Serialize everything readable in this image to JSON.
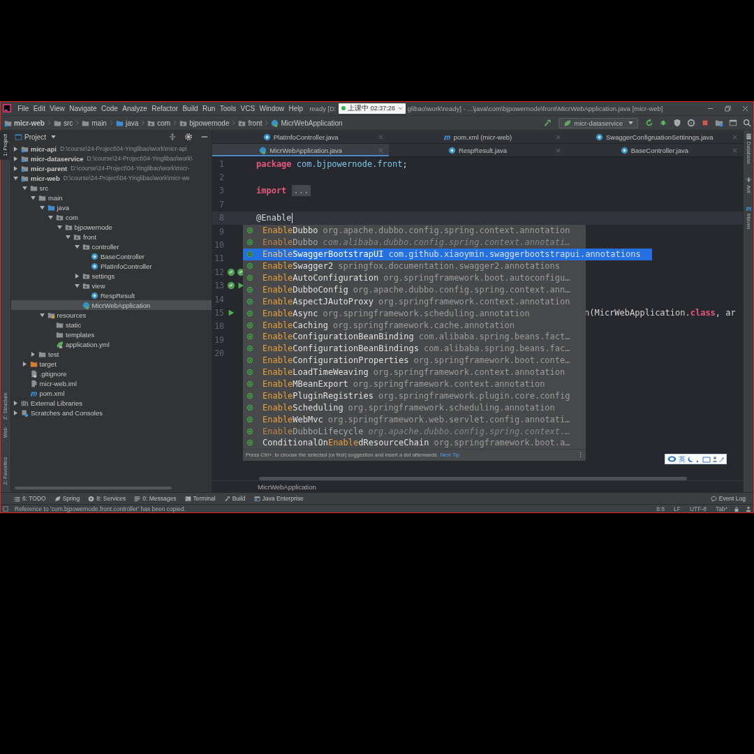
{
  "title_bar": {
    "menus": [
      "File",
      "Edit",
      "View",
      "Navigate",
      "Code",
      "Analyze",
      "Refactor",
      "Build",
      "Run",
      "Tools",
      "VCS",
      "Window",
      "Help"
    ],
    "title_start": "ready [D:",
    "title_end": "glibao\\work\\ready] - ...\\java\\com\\bjpowernode\\front\\MicrWebApplication.java [micr-web]"
  },
  "class_timer": {
    "label": "上课中",
    "time": "02:37:28"
  },
  "nav_bar": {
    "breadcrumbs": [
      {
        "label": "micr-web",
        "kind": "module"
      },
      {
        "label": "src",
        "kind": "folder"
      },
      {
        "label": "main",
        "kind": "folder"
      },
      {
        "label": "java",
        "kind": "source"
      },
      {
        "label": "com",
        "kind": "package"
      },
      {
        "label": "bjpowernode",
        "kind": "package"
      },
      {
        "label": "front",
        "kind": "package"
      },
      {
        "label": "MicrWebApplication",
        "kind": "app-class"
      }
    ],
    "run_config": "micr-dataservice"
  },
  "left_stripe": [
    {
      "label": "1: Project",
      "selected": true
    },
    {
      "label": "Z: Structure",
      "selected": false
    },
    {
      "label": "Web",
      "selected": false
    },
    {
      "label": "2: Favorites",
      "selected": false
    }
  ],
  "project": {
    "title": "Project",
    "tree": [
      {
        "label": "micr-api",
        "path": "D:\\course\\24-Project\\04-Yinglibao\\work\\micr-api",
        "kind": "module",
        "expanded": false,
        "selected": false
      },
      {
        "label": "micr-dataservice",
        "path": "D:\\course\\24-Project\\04-Yinglibao\\work\\",
        "kind": "module",
        "expanded": false,
        "selected": false
      },
      {
        "label": "micr-parent",
        "path": "D:\\course\\24-Project\\04-Yinglibao\\work\\micr-",
        "kind": "module",
        "expanded": false,
        "selected": false
      },
      {
        "label": "micr-web",
        "path": "D:\\course\\24-Project\\04-Yinglibao\\work\\micr-we",
        "kind": "module",
        "expanded": true,
        "selected": false,
        "children": [
          {
            "label": "src",
            "kind": "folder",
            "expanded": true,
            "selected": false,
            "children": [
              {
                "label": "main",
                "kind": "folder",
                "expanded": true,
                "selected": false,
                "children": [
                  {
                    "label": "java",
                    "kind": "source",
                    "expanded": true,
                    "selected": false,
                    "children": [
                      {
                        "label": "com",
                        "kind": "package",
                        "expanded": true,
                        "selected": false,
                        "children": [
                          {
                            "label": "bjpowernode",
                            "kind": "package",
                            "expanded": true,
                            "selected": false,
                            "children": [
                              {
                                "label": "front",
                                "kind": "package",
                                "expanded": true,
                                "selected": false,
                                "children": [
                                  {
                                    "label": "controller",
                                    "kind": "package",
                                    "expanded": true,
                                    "selected": false,
                                    "children": [
                                      {
                                        "label": "BaseController",
                                        "kind": "class",
                                        "selected": false
                                      },
                                      {
                                        "label": "PlatInfoController",
                                        "kind": "class",
                                        "selected": false
                                      }
                                    ]
                                  },
                                  {
                                    "label": "settings",
                                    "kind": "package",
                                    "expanded": false,
                                    "selected": false
                                  },
                                  {
                                    "label": "view",
                                    "kind": "package",
                                    "expanded": true,
                                    "selected": false,
                                    "children": [
                                      {
                                        "label": "RespResult",
                                        "kind": "class",
                                        "selected": false
                                      }
                                    ]
                                  },
                                  {
                                    "label": "MicrWebApplication",
                                    "kind": "app-class",
                                    "selected": true
                                  }
                                ]
                              }
                            ]
                          }
                        ]
                      }
                    ]
                  },
                  {
                    "label": "resources",
                    "kind": "resources",
                    "expanded": true,
                    "selected": false,
                    "children": [
                      {
                        "label": "static",
                        "kind": "folder",
                        "selected": false
                      },
                      {
                        "label": "templates",
                        "kind": "folder",
                        "selected": false
                      },
                      {
                        "label": "application.yml",
                        "kind": "yml",
                        "selected": false
                      }
                    ]
                  }
                ]
              },
              {
                "label": "test",
                "kind": "folder",
                "expanded": false,
                "selected": false
              }
            ]
          },
          {
            "label": "target",
            "kind": "excluded",
            "expanded": false,
            "selected": false
          },
          {
            "label": ".gitignore",
            "kind": "gitignore",
            "selected": false
          },
          {
            "label": "micr-web.iml",
            "kind": "iml",
            "selected": false
          },
          {
            "label": "pom.xml",
            "kind": "maven",
            "selected": false
          }
        ]
      },
      {
        "label": "External Libraries",
        "kind": "libraries",
        "expanded": false,
        "selected": false
      },
      {
        "label": "Scratches and Consoles",
        "kind": "scratches",
        "expanded": false,
        "selected": false
      }
    ]
  },
  "editor": {
    "tab_rows": [
      [
        {
          "label": "PlatInfoController.java",
          "kind": "class",
          "selected": false
        },
        {
          "label": "pom.xml (micr-web)",
          "kind": "maven",
          "selected": false
        },
        {
          "label": "SwaggerConfigruationSettinngs.java",
          "kind": "class",
          "selected": false
        }
      ],
      [
        {
          "label": "MicrWebApplication.java",
          "kind": "app-class",
          "selected": true
        },
        {
          "label": "RespResult.java",
          "kind": "class",
          "selected": false
        },
        {
          "label": "BaseController.java",
          "kind": "class",
          "selected": false
        }
      ]
    ],
    "lines": [
      {
        "number": "1",
        "current": false,
        "tokens": [
          {
            "text": "package",
            "kind": "keyword"
          },
          {
            "text": "com.bjpowernode.front",
            "kind": "package"
          },
          {
            "text": ";",
            "kind": "plain"
          }
        ]
      },
      {
        "number": "2",
        "current": false
      },
      {
        "number": "3",
        "current": false,
        "tokens": [
          {
            "text": "import",
            "kind": "keyword"
          },
          {
            "text": "...",
            "kind": "fold"
          }
        ]
      },
      {
        "number": "7",
        "current": false
      },
      {
        "number": "8",
        "current": true,
        "tokens": [
          {
            "text": "@Enable",
            "kind": "plain"
          }
        ]
      },
      {
        "number": "9",
        "current": false
      },
      {
        "number": "10",
        "current": false
      },
      {
        "number": "11",
        "current": false
      },
      {
        "number": "12",
        "current": false,
        "gutter": [
          {
            "kind": "bean"
          },
          {
            "kind": "bean"
          }
        ]
      },
      {
        "number": "13",
        "current": false,
        "gutter": [
          {
            "kind": "bean"
          },
          {
            "kind": "run"
          }
        ]
      },
      {
        "number": "14",
        "current": false
      },
      {
        "number": "15",
        "current": false,
        "occluded": true,
        "gutter": [
          {
            "kind": "run"
          }
        ],
        "tokens": [
          {
            "text": "n(MicrWebApplication.",
            "kind": "plain"
          },
          {
            "text": "class",
            "kind": "keyword"
          },
          {
            "text": ", ar",
            "kind": "plain"
          }
        ]
      },
      {
        "number": "18",
        "current": false
      },
      {
        "number": "19",
        "current": false
      },
      {
        "number": "20",
        "current": false
      }
    ],
    "completion": {
      "items": [
        {
          "match": "Enable",
          "after": "Dubbo",
          "package": "org.apache.dubbo.config.spring.context.annotation",
          "selected": false,
          "deprecated": false
        },
        {
          "match": "Enable",
          "after": "Dubbo",
          "package": "com.alibaba.dubbo.config.spring.context.annotati…",
          "selected": false,
          "deprecated": true
        },
        {
          "match": "Enable",
          "after": "SwaggerBootstrapUI",
          "package": "com.github.xiaoymin.swaggerbootstrapui.annotations",
          "selected": true,
          "deprecated": false
        },
        {
          "match": "Enable",
          "after": "Swagger2",
          "package": "springfox.documentation.swagger2.annotations",
          "selected": false,
          "deprecated": false
        },
        {
          "match": "Enable",
          "after": "AutoConfiguration",
          "package": "org.springframework.boot.autoconfigu…",
          "selected": false,
          "deprecated": false
        },
        {
          "match": "Enable",
          "after": "DubboConfig",
          "package": "org.apache.dubbo.config.spring.context.ann…",
          "selected": false,
          "deprecated": false
        },
        {
          "match": "Enable",
          "after": "AspectJAutoProxy",
          "package": "org.springframework.context.annotation",
          "selected": false,
          "deprecated": false
        },
        {
          "match": "Enable",
          "after": "Async",
          "package": "org.springframework.scheduling.annotation",
          "selected": false,
          "deprecated": false
        },
        {
          "match": "Enable",
          "after": "Caching",
          "package": "org.springframework.cache.annotation",
          "selected": false,
          "deprecated": false
        },
        {
          "match": "Enable",
          "after": "ConfigurationBeanBinding",
          "package": "com.alibaba.spring.beans.fact…",
          "selected": false,
          "deprecated": false
        },
        {
          "match": "Enable",
          "after": "ConfigurationBeanBindings",
          "package": "com.alibaba.spring.beans.fac…",
          "selected": false,
          "deprecated": false
        },
        {
          "match": "Enable",
          "after": "ConfigurationProperties",
          "package": "org.springframework.boot.conte…",
          "selected": false,
          "deprecated": false
        },
        {
          "match": "Enable",
          "after": "LoadTimeWeaving",
          "package": "org.springframework.context.annotation",
          "selected": false,
          "deprecated": false
        },
        {
          "match": "Enable",
          "after": "MBeanExport",
          "package": "org.springframework.context.annotation",
          "selected": false,
          "deprecated": false
        },
        {
          "match": "Enable",
          "after": "PluginRegistries",
          "package": "org.springframework.plugin.core.config",
          "selected": false,
          "deprecated": false
        },
        {
          "match": "Enable",
          "after": "Scheduling",
          "package": "org.springframework.scheduling.annotation",
          "selected": false,
          "deprecated": false
        },
        {
          "match": "Enable",
          "after": "WebMvc",
          "package": "org.springframework.web.servlet.config.annotati…",
          "selected": false,
          "deprecated": false
        },
        {
          "match": "Enable",
          "after": "DubboLifecycle",
          "package": "org.apache.dubbo.config.spring.context.…",
          "selected": false,
          "deprecated": true
        },
        {
          "before": "ConditionalOn",
          "match": "Enable",
          "after": "dResourceChain",
          "package": "org.springframework.boot.a…",
          "selected": false,
          "deprecated": false
        }
      ],
      "hint": "Press Ctrl+. to choose the selected (or first) suggestion and insert a dot afterwards",
      "hint_link": "Next Tip"
    },
    "breadcrumb": "MicrWebApplication"
  },
  "right_stripe": [
    {
      "label": "Database",
      "kind": "database"
    },
    {
      "label": "Ant",
      "kind": "ant"
    },
    {
      "label": "Maven",
      "kind": "maven"
    }
  ],
  "ime_toolbar": {
    "mode": "英"
  },
  "tool_windows": [
    {
      "label": "6: TODO",
      "kind": "todo"
    },
    {
      "label": "Spring",
      "kind": "spring"
    },
    {
      "label": "8: Services",
      "kind": "services"
    },
    {
      "label": "0: Messages",
      "kind": "messages"
    },
    {
      "label": "Terminal",
      "kind": "terminal"
    },
    {
      "label": "Build",
      "kind": "build"
    },
    {
      "label": "Java Enterprise",
      "kind": "enterprise"
    }
  ],
  "event_log": "Event Log",
  "status_bar": {
    "message": "Reference to 'com.bjpowernode.front.controller' has been copied.",
    "position": "8:8",
    "line_separator": "LF",
    "encoding": "UTF-8",
    "indent": "Tab*"
  }
}
